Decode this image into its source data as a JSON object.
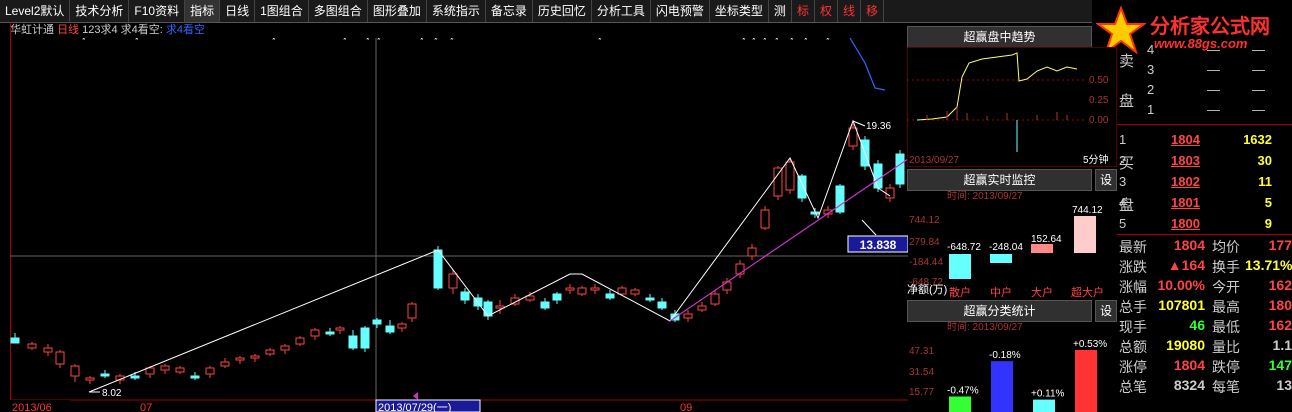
{
  "toolbar": {
    "items": [
      "Level2默认",
      "技术分析",
      "F10资料",
      "指标",
      "日线",
      "1图组合",
      "多图组合",
      "图形叠加",
      "系统指示",
      "备忘录",
      "历史回忆",
      "分析工具",
      "闪电预警",
      "坐标类型",
      "测",
      "标",
      "权",
      "线",
      "移"
    ],
    "active_item": "指标"
  },
  "logo": {
    "main": "分析家公式网",
    "url": "www.88gs.com"
  },
  "subheader": {
    "indicator": "华虹计通",
    "period": "日线",
    "params": "123求4",
    "params2": "求4看空:",
    "value": "求4看空"
  },
  "chart": {
    "label_low": "8.02",
    "label_high": "19.36",
    "price_tag": "13.838",
    "x_labels": [
      "2013/06",
      "07",
      "2013/07/29(一)",
      "09"
    ],
    "ma_color": "#ffffff",
    "trend_color": "#cc33cc"
  },
  "intraday": {
    "title": "超赢盘中趋势",
    "date": "2013/09/27",
    "period": "5分钟",
    "y_labels": [
      "0.50",
      "0.25",
      "0.00"
    ],
    "setting": "设"
  },
  "monitor": {
    "title": "超赢实时监控",
    "time_label": "时间: 2013/09/27",
    "y_labels": [
      "744.12",
      "279.84",
      "-184.44",
      "-648.72"
    ],
    "bars": [
      {
        "label": "散户",
        "value": "-648.72",
        "color": "#66ffff"
      },
      {
        "label": "中户",
        "value": "-248.04",
        "color": "#66ffff"
      },
      {
        "label": "大户",
        "value": "152.64",
        "color": "#ff6666"
      },
      {
        "label": "超大户",
        "value": "744.12",
        "color": "#ff6666"
      }
    ],
    "axis_name": "净额(万)",
    "setting": "设"
  },
  "classify": {
    "title": "超赢分类统计",
    "time_label": "时间: 2013/09/27",
    "y_labels": [
      "47.31",
      "31.54",
      "15.77"
    ],
    "bars": [
      {
        "value": "-0.47%",
        "color": "#33ff33",
        "level": 0.25
      },
      {
        "value": "-0.18%",
        "color": "#3333ff",
        "level": 0.82
      },
      {
        "value": "+0.11%",
        "color": "#66ffff",
        "level": 0.2
      },
      {
        "value": "+0.53%",
        "color": "#ff3333",
        "level": 1.0
      }
    ],
    "setting": "设"
  },
  "orderbook": {
    "sell_label": [
      "卖",
      "盘"
    ],
    "buy_label": [
      "买",
      "盘"
    ],
    "sell": [
      {
        "n": "4",
        "price": "—",
        "vol": "—"
      },
      {
        "n": "3",
        "price": "—",
        "vol": "—"
      },
      {
        "n": "2",
        "price": "—",
        "vol": "—"
      },
      {
        "n": "1",
        "price": "—",
        "vol": "—"
      }
    ],
    "buy": [
      {
        "n": "1",
        "price": "1804",
        "vol": "1632"
      },
      {
        "n": "2",
        "price": "1803",
        "vol": "30"
      },
      {
        "n": "3",
        "price": "1802",
        "vol": "11"
      },
      {
        "n": "4",
        "price": "1801",
        "vol": "5"
      },
      {
        "n": "5",
        "price": "1800",
        "vol": "9"
      }
    ]
  },
  "stats": [
    {
      "l1": "最新",
      "v1": "1804",
      "l2": "均价",
      "v2": "177"
    },
    {
      "l1": "涨跌",
      "v1": "▲164",
      "l2": "换手",
      "v2": "13.71%"
    },
    {
      "l1": "涨幅",
      "v1": "10.00%",
      "l2": "今开",
      "v2": "162"
    },
    {
      "l1": "总手",
      "v1": "107801",
      "l2": "最高",
      "v2": "180"
    },
    {
      "l1": "现手",
      "v1": "46",
      "l2": "最低",
      "v2": "162"
    },
    {
      "l1": "总额",
      "v1": "19080",
      "l2": "量比",
      "v2": "1.1"
    },
    {
      "l1": "涨停",
      "v1": "1804",
      "l2": "跌停",
      "v2": "147"
    },
    {
      "l1": "总笔",
      "v1": "8324",
      "l2": "每笔",
      "v2": "13"
    }
  ]
}
